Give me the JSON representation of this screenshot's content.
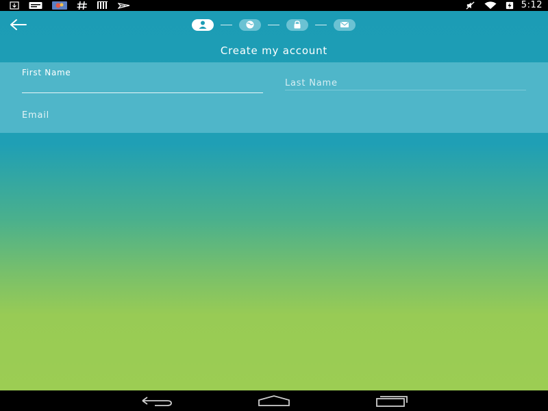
{
  "status_bar": {
    "time": "5:12",
    "left_icons": [
      "download-icon",
      "news-icon",
      "photo-icon",
      "hashtag-icon",
      "barcode-icon",
      "plane-icon"
    ],
    "right_icons": [
      "mute-icon",
      "wifi-icon",
      "battery-charging-icon"
    ]
  },
  "header": {
    "back_icon": "arrow-left-icon",
    "title": "Create my account",
    "steps": [
      {
        "icon": "person-icon",
        "active": true
      },
      {
        "icon": "globe-icon",
        "active": false
      },
      {
        "icon": "lock-icon",
        "active": false
      },
      {
        "icon": "mail-icon",
        "active": false
      }
    ]
  },
  "form": {
    "first_name": {
      "label": "First Name",
      "value": ""
    },
    "last_name": {
      "placeholder": "Last Name"
    },
    "email": {
      "placeholder": "Email"
    }
  },
  "nav_bar": {
    "buttons": [
      "back-nav-icon",
      "home-nav-icon",
      "recents-nav-icon"
    ]
  },
  "colors": {
    "header_teal": "#1c9cb5",
    "form_panel": "#4fb6c9",
    "gradient_bottom": "#9ccd53",
    "step_inactive": "#6bc2d3"
  }
}
